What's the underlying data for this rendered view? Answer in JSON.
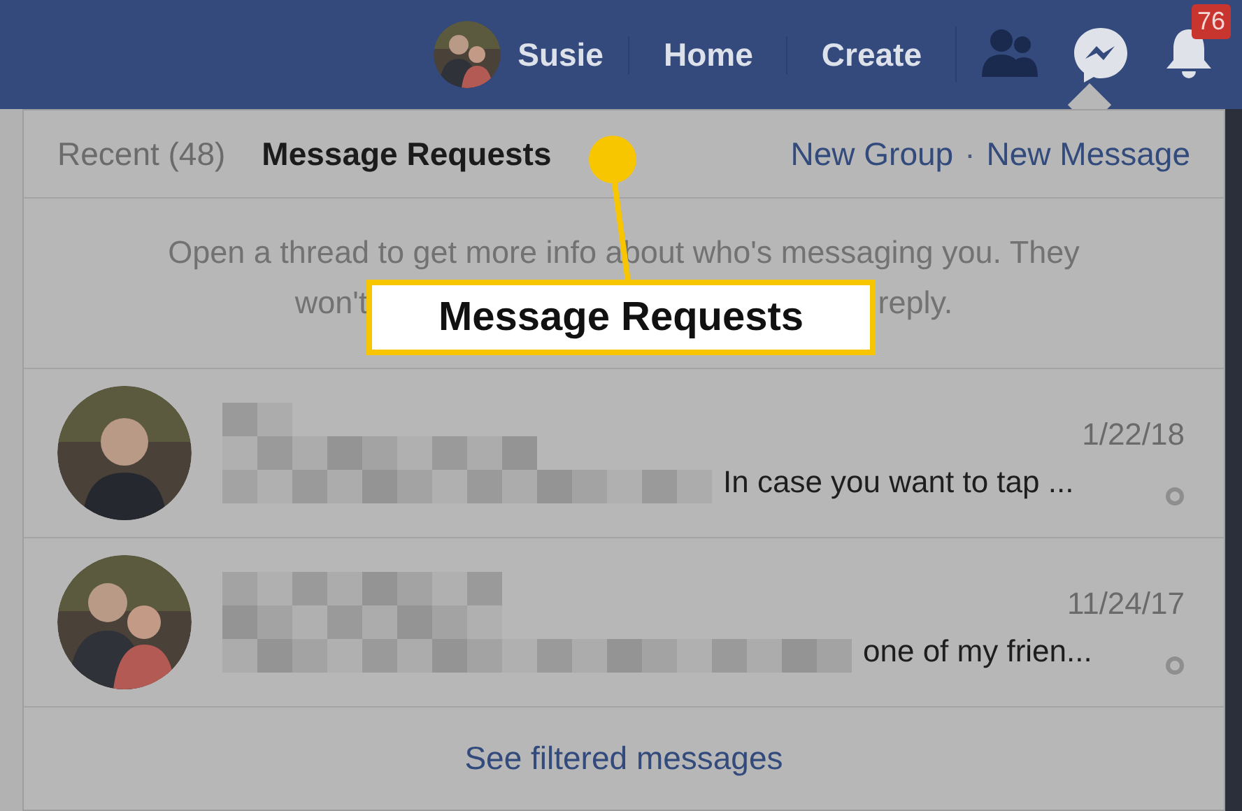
{
  "top_bar": {
    "profile": {
      "name": "Susie"
    },
    "links": [
      "Home",
      "Create"
    ],
    "notifications_badge": "76"
  },
  "dropdown": {
    "tabs": [
      {
        "label": "Recent (48)",
        "selected": false
      },
      {
        "label": "Message Requests",
        "selected": true
      }
    ],
    "actions": [
      "New Group",
      "New Message"
    ],
    "separator": "·",
    "notice": {
      "line_1": "Open a thread to get more info about who's messaging you. They",
      "line_2_start": "won't",
      "line_2_end": "reply."
    },
    "threads": [
      {
        "date": "1/22/18",
        "snippet": "In case you want to tap ..."
      },
      {
        "date": "11/24/17",
        "snippet": "one of my frien..."
      }
    ],
    "footer_link": "See filtered messages"
  },
  "callout": {
    "label": "Message Requests"
  }
}
